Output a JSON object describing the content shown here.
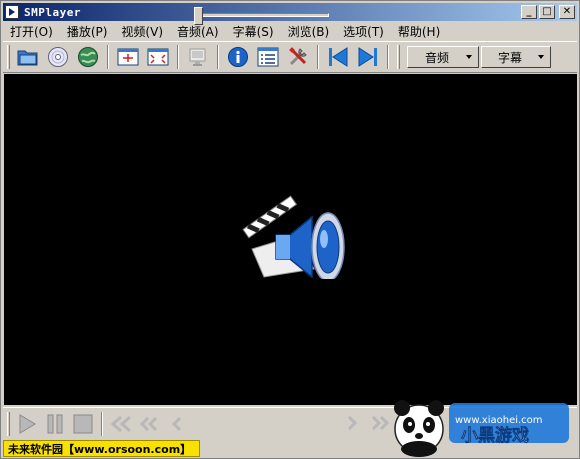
{
  "window": {
    "title": "SMPlayer"
  },
  "title_buttons": {
    "minimize": "_",
    "maximize": "□",
    "close": "✕"
  },
  "menu": [
    {
      "label": "打开(O)"
    },
    {
      "label": "播放(P)"
    },
    {
      "label": "视频(V)"
    },
    {
      "label": "音频(A)"
    },
    {
      "label": "字幕(S)"
    },
    {
      "label": "浏览(B)"
    },
    {
      "label": "选项(T)"
    },
    {
      "label": "帮助(H)"
    }
  ],
  "toolbar": {
    "audio_combo": "音频",
    "subtitle_combo": "字幕"
  },
  "status": {
    "text": "未来软件园【www.orsoon.com】"
  },
  "watermark": {
    "brand": "小黑游戏",
    "url": "www.xiaohei.com"
  },
  "colors": {
    "titlebar_start": "#0a246a",
    "titlebar_end": "#a6caf0",
    "video_bg": "#000000",
    "status_bg": "#f8e000",
    "icon_blue": "#1e64c8"
  }
}
